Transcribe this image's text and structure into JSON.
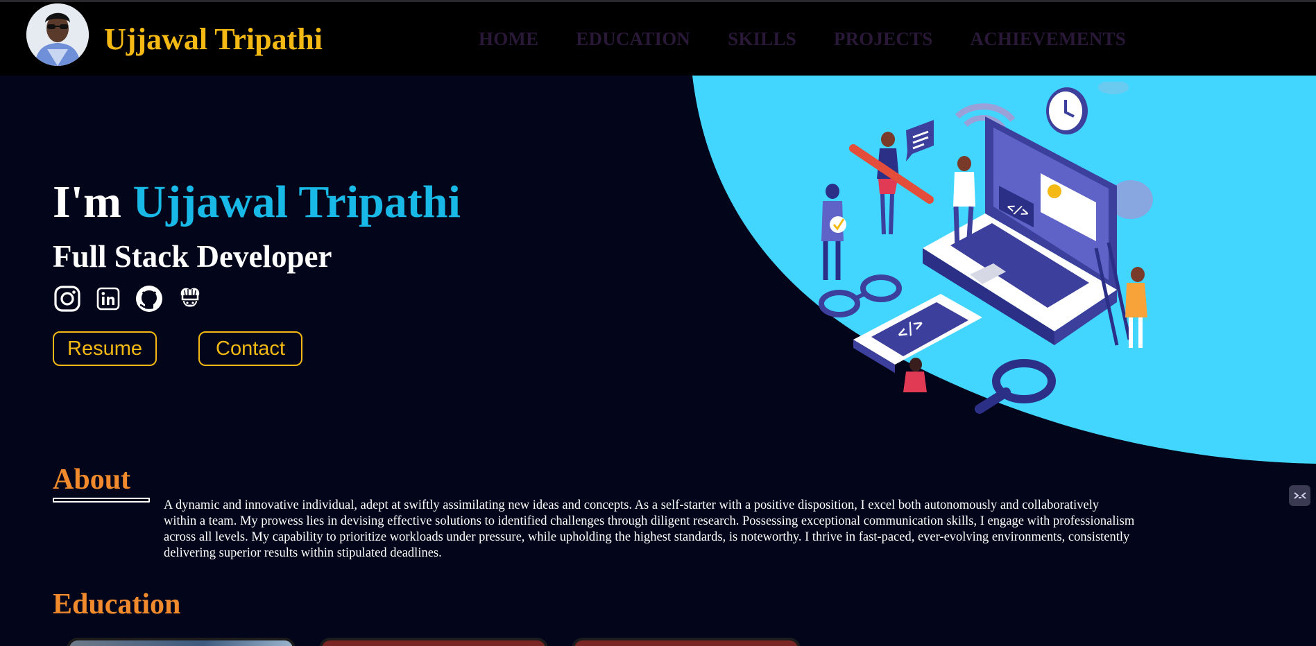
{
  "brand": {
    "name": "Ujjawal Tripathi",
    "avatar_icon": "profile-photo"
  },
  "nav": {
    "items": [
      {
        "label": "HOME"
      },
      {
        "label": "EDUCATION"
      },
      {
        "label": "SKILLS"
      },
      {
        "label": "PROJECTS"
      },
      {
        "label": "ACHIEVEMENTS"
      }
    ]
  },
  "hero": {
    "greeting": "I'm",
    "name": "Ujjawal Tripathi",
    "role": "Full Stack Developer",
    "socials": [
      {
        "icon": "instagram-icon"
      },
      {
        "icon": "linkedin-icon"
      },
      {
        "icon": "github-icon"
      },
      {
        "icon": "codechef-icon"
      }
    ],
    "resume_label": "Resume",
    "contact_label": "Contact"
  },
  "about": {
    "title": "About",
    "text": "A dynamic and innovative individual, adept at swiftly assimilating new ideas and concepts. As a self-starter with a positive disposition, I excel both autonomously and collaboratively within a team. My prowess lies in devising effective solutions to identified challenges through diligent research. Possessing exceptional communication skills, I engage with professionalism across all levels. My capability to prioritize workloads under pressure, while upholding the highest standards, is noteworthy. I thrive in fast-paced, ever-evolving environments, consistently delivering superior results within stipulated deadlines."
  },
  "education": {
    "title": "Education"
  },
  "colors": {
    "brand_gold": "#f5b914",
    "accent_cyan": "#18b9e6",
    "section_orange": "#f08a2c",
    "hero_bg_blue": "#42d6ff",
    "page_bg": "#03061a"
  }
}
